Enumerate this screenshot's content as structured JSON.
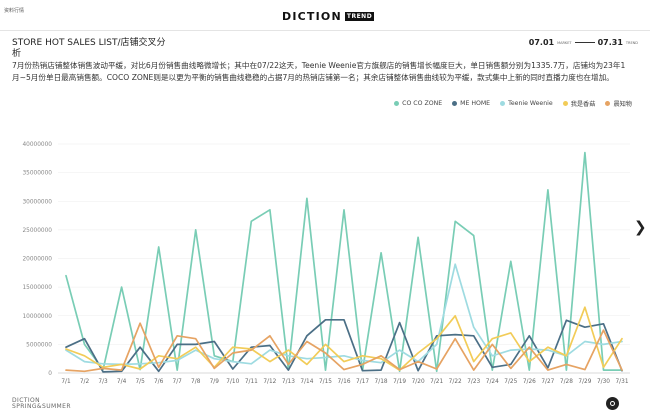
{
  "header": {
    "crumb": "资料行情",
    "brand": "DICTION",
    "brand_sub": "TREND"
  },
  "title": "STORE HOT SALES LIST/店铺交叉分析",
  "date_range": {
    "start": "07.01",
    "start_sub": "MARKET",
    "end": "07.31",
    "end_sub": "TREND"
  },
  "description": "7月份热销店铺整体销售波动平缓，对比6月份销售曲线略微增长；其中在07/22这天，Teenie Weenie官方旗舰店的销售增长幅度巨大，单日销售额分别为1335.7万，店铺均为23年1月~5月份单日最高销售额。COCO ZONE则是以更为平衡的销售曲线稳稳的占据7月的热销店铺第一名；其余店铺整体销售曲线较为平缓，款式集中上新的同时直播力度也在增加。",
  "footer": {
    "logo_line1": "DICTION",
    "logo_line2": "SPRING&SUMMER"
  },
  "chart_data": {
    "type": "line",
    "categories": [
      "7/1",
      "7/2",
      "7/3",
      "7/4",
      "7/5",
      "7/6",
      "7/7",
      "7/8",
      "7/9",
      "7/10",
      "7/11",
      "7/12",
      "7/13",
      "7/14",
      "7/15",
      "7/16",
      "7/17",
      "7/18",
      "7/19",
      "7/20",
      "7/21",
      "7/22",
      "7/23",
      "7/24",
      "7/25",
      "7/26",
      "7/27",
      "7/28",
      "7/29",
      "7/30",
      "7/31"
    ],
    "ylim": [
      0,
      40000000
    ],
    "yticks": [
      "0",
      "5000000",
      "10000000",
      "15000000",
      "20000000",
      "25000000",
      "30000000",
      "35000000",
      "40000000"
    ],
    "grid": true,
    "legend_position": "top-right",
    "series": [
      {
        "name": "CO CO ZONE",
        "color": "#79cdb5",
        "values": [
          17000000,
          5000000,
          600000,
          15000000,
          600000,
          22000000,
          500000,
          25000000,
          3000000,
          2000000,
          26500000,
          28500000,
          600000,
          30500000,
          500000,
          28500000,
          400000,
          21000000,
          300000,
          23700000,
          300000,
          26500000,
          24000000,
          500000,
          19500000,
          500000,
          32000000,
          500000,
          38500000,
          500000,
          500000
        ]
      },
      {
        "name": "ME HOME",
        "color": "#4b6f86",
        "values": [
          4500000,
          6000000,
          200000,
          300000,
          4500000,
          300000,
          5000000,
          5000000,
          5500000,
          700000,
          4500000,
          4800000,
          500000,
          6500000,
          9300000,
          9300000,
          400000,
          500000,
          8800000,
          400000,
          6500000,
          6700000,
          6500000,
          1000000,
          1500000,
          6500000,
          900000,
          9200000,
          8000000,
          8600000,
          400000
        ]
      },
      {
        "name": "Teenie Weenie",
        "color": "#9edbe1",
        "values": [
          4000000,
          2000000,
          1600000,
          1500000,
          1600000,
          1800000,
          2200000,
          4000000,
          2500000,
          2000000,
          1600000,
          4000000,
          3000000,
          2500000,
          2700000,
          3000000,
          2200000,
          1800000,
          4000000,
          2000000,
          5000000,
          19000000,
          8000000,
          3000000,
          4000000,
          4200000,
          4000000,
          3000000,
          5500000,
          5000000,
          5500000
        ]
      },
      {
        "name": "我是香菇",
        "color": "#f2cc58",
        "values": [
          4200000,
          3000000,
          1000000,
          1500000,
          700000,
          3000000,
          2500000,
          4500000,
          1000000,
          4500000,
          4200000,
          2000000,
          4000000,
          1500000,
          5000000,
          2000000,
          3000000,
          2500000,
          500000,
          3500000,
          6000000,
          10000000,
          2000000,
          6000000,
          7000000,
          2000000,
          4500000,
          3000000,
          11500000,
          1000000,
          6000000
        ]
      },
      {
        "name": "晨知物",
        "color": "#e6a363",
        "values": [
          500000,
          300000,
          800000,
          500000,
          8700000,
          1000000,
          6500000,
          6000000,
          800000,
          3500000,
          4000000,
          6500000,
          1500000,
          5500000,
          3500000,
          600000,
          1500000,
          3000000,
          600000,
          2000000,
          700000,
          6000000,
          500000,
          5000000,
          800000,
          4500000,
          500000,
          1500000,
          600000,
          7500000,
          500000
        ]
      }
    ]
  }
}
